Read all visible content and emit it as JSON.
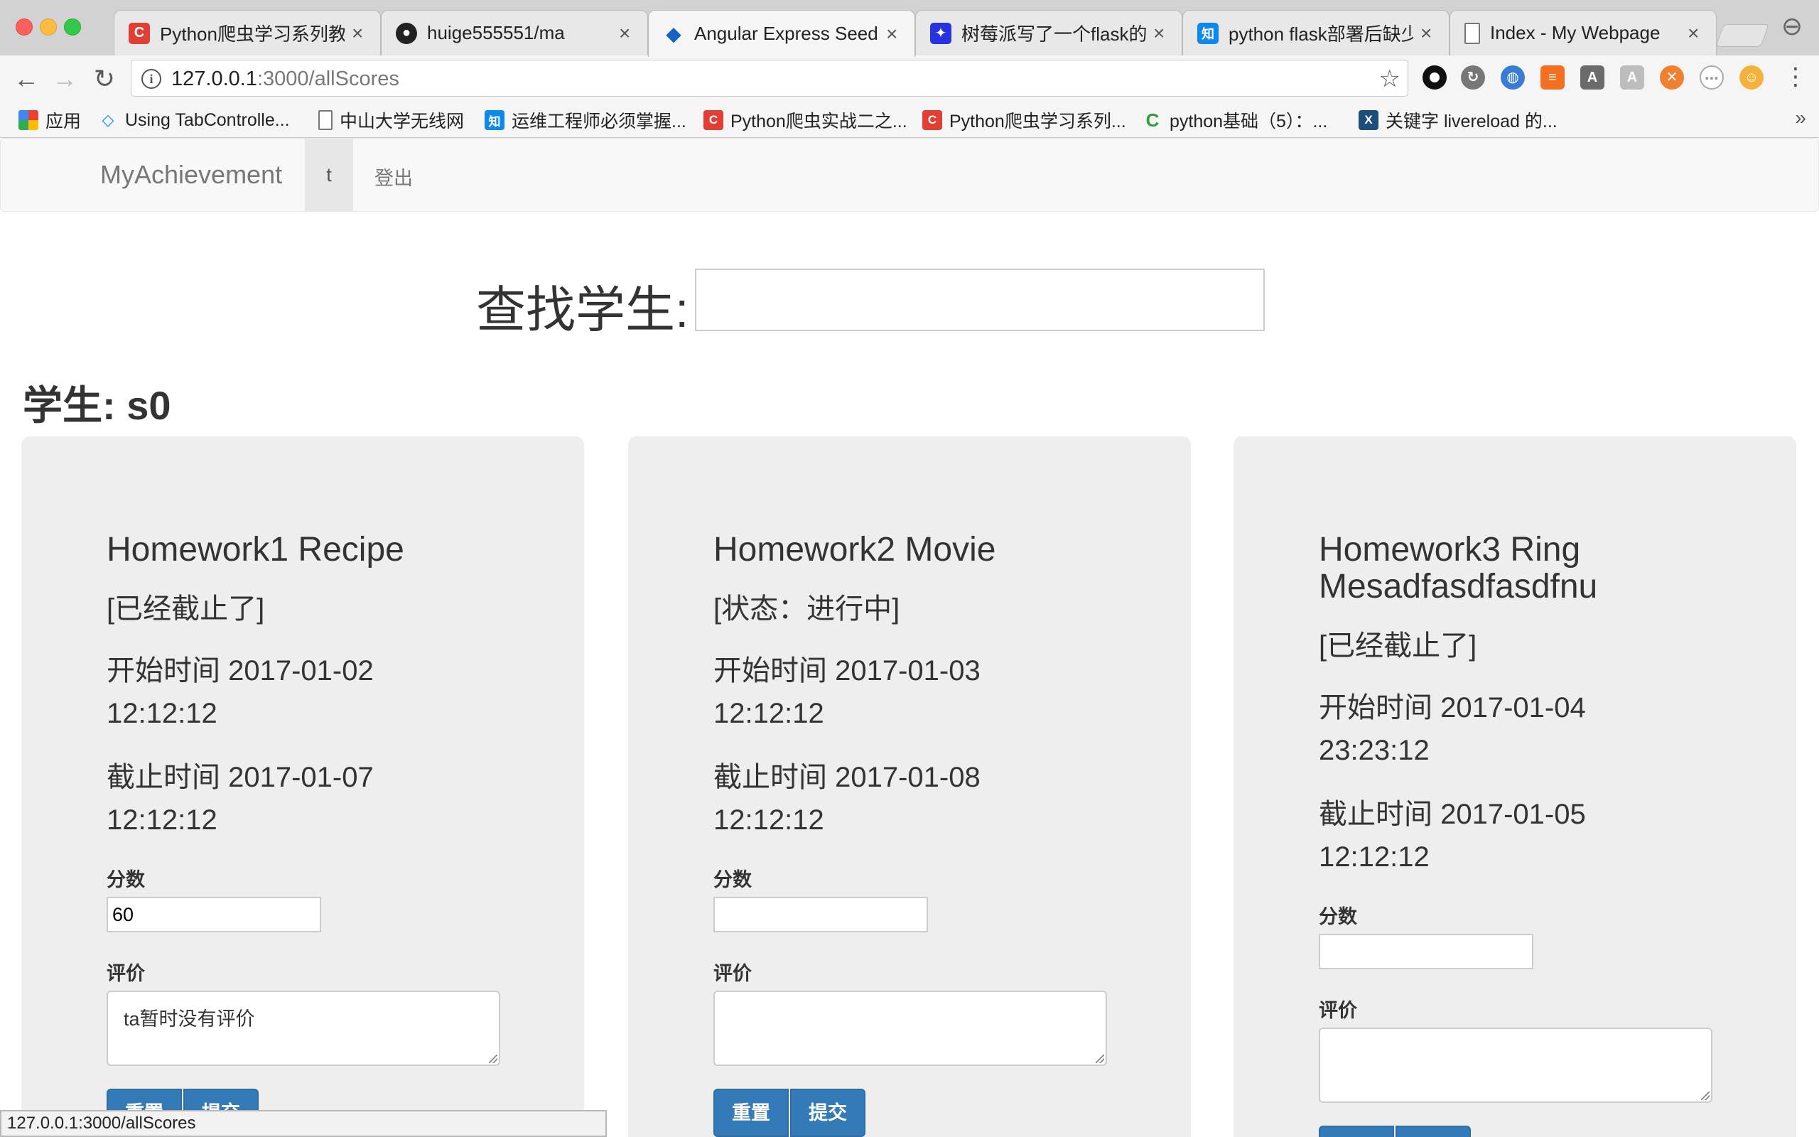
{
  "browser": {
    "tabs": [
      {
        "title": "Python爬虫学习系列教程",
        "icon": "csdn-icon",
        "icon_color": "#e33e33",
        "icon_glyph": "C"
      },
      {
        "title": "huige555551/ma",
        "icon": "github-icon",
        "icon_color": "#222222",
        "icon_glyph": "●"
      },
      {
        "title": "Angular Express Seed A",
        "icon": "angular-icon",
        "icon_color": "#1565c0",
        "icon_glyph": "◆"
      },
      {
        "title": "树莓派写了一个flask的程",
        "icon": "baidu-icon",
        "icon_color": "#2932e1",
        "icon_glyph": "✦"
      },
      {
        "title": "python flask部署后缺少",
        "icon": "zhihu-icon",
        "icon_color": "#0f88eb",
        "icon_glyph": "知"
      },
      {
        "title": "Index - My Webpage",
        "icon": "page-icon",
        "icon_color": "#ffffff",
        "icon_glyph": ""
      }
    ],
    "url_host": "127.0.0.1",
    "url_rest": ":3000/allScores",
    "bookmarks": [
      {
        "label": "应用",
        "icon": "apps-icon",
        "icon_color": "#e94235",
        "icon_glyph": "⁙"
      },
      {
        "label": "Using TabControlle...",
        "icon": "code-icon",
        "icon_color": "#1e88e5",
        "icon_glyph": "<>"
      },
      {
        "label": "中山大学无线网",
        "icon": "page-icon",
        "icon_color": "#ffffff",
        "icon_glyph": ""
      },
      {
        "label": "运维工程师必须掌握...",
        "icon": "zhihu-icon",
        "icon_color": "#0f88eb",
        "icon_glyph": "知"
      },
      {
        "label": "Python爬虫实战二之...",
        "icon": "csdn-icon",
        "icon_color": "#e33e33",
        "icon_glyph": "C"
      },
      {
        "label": "Python爬虫学习系列...",
        "icon": "csdn-icon",
        "icon_color": "#e33e33",
        "icon_glyph": "C"
      },
      {
        "label": "python基础（5）：...",
        "icon": "c-icon",
        "icon_color": "#2e9e3e",
        "icon_glyph": "C"
      },
      {
        "label": "关键字 livereload 的...",
        "icon": "x-icon",
        "icon_color": "#1d4e7a",
        "icon_glyph": "X"
      }
    ],
    "bookmarks_more": "»",
    "status_url": "127.0.0.1:3000/allScores"
  },
  "navbar": {
    "brand": "MyAchievement",
    "user": "t",
    "logout": "登出"
  },
  "search": {
    "label": "查找学生:",
    "value": ""
  },
  "student": {
    "title": "学生: s0"
  },
  "homeworks": [
    {
      "title": "Homework1 Recipe",
      "status": "[已经截止了]",
      "start_label": "开始时间",
      "start_date": "2017-01-02",
      "start_time": "12:12:12",
      "end_label": "截止时间",
      "end_date": "2017-01-07",
      "end_time": "12:12:12",
      "score_label": "分数",
      "score_value": "60",
      "comment_label": "评价",
      "comment_value": "ta暂时没有评价",
      "reset_label": "重置",
      "submit_label": "提交"
    },
    {
      "title": "Homework2 Movie",
      "status": "[状态：进行中]",
      "start_label": "开始时间",
      "start_date": "2017-01-03",
      "start_time": "12:12:12",
      "end_label": "截止时间",
      "end_date": "2017-01-08",
      "end_time": "12:12:12",
      "score_label": "分数",
      "score_value": "",
      "comment_label": "评价",
      "comment_value": "",
      "reset_label": "重置",
      "submit_label": "提交"
    },
    {
      "title": "Homework3 Ring Mesadfasdfasdfnu",
      "status": "[已经截止了]",
      "start_label": "开始时间",
      "start_date": "2017-01-04",
      "start_time": "23:23:12",
      "end_label": "截止时间",
      "end_date": "2017-01-05",
      "end_time": "12:12:12",
      "score_label": "分数",
      "score_value": "",
      "comment_label": "评价",
      "comment_value": "",
      "reset_label": "重置",
      "submit_label": "提交"
    }
  ],
  "colors": {
    "primary_button": "#337ab7",
    "card_background": "#eeeeee",
    "navbar_background": "#f8f8f8"
  }
}
